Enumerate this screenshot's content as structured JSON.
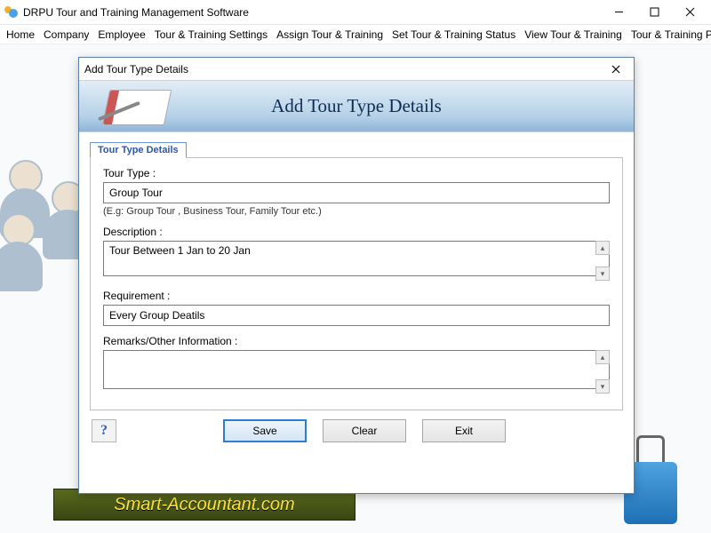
{
  "app": {
    "title": "DRPU Tour and Training Management Software"
  },
  "menu": {
    "items": [
      "Home",
      "Company",
      "Employee",
      "Tour & Training Settings",
      "Assign Tour & Training",
      "Set Tour & Training Status",
      "View Tour & Training",
      "Tour & Training Pass"
    ]
  },
  "logo": {
    "text": "Smart-Accountant.com"
  },
  "dialog": {
    "title": "Add Tour Type Details",
    "heading": "Add Tour Type Details",
    "tab_label": "Tour Type Details",
    "fields": {
      "tour_type_label": "Tour Type :",
      "tour_type_value": "Group Tour",
      "tour_type_hint": "(E.g: Group Tour , Business Tour, Family Tour etc.)",
      "description_label": "Description :",
      "description_value": "Tour Between 1 Jan to 20 Jan",
      "requirement_label": "Requirement :",
      "requirement_value": "Every Group Deatils",
      "remarks_label": "Remarks/Other Information :",
      "remarks_value": ""
    },
    "buttons": {
      "save": "Save",
      "clear": "Clear",
      "exit": "Exit",
      "help": "?"
    }
  }
}
